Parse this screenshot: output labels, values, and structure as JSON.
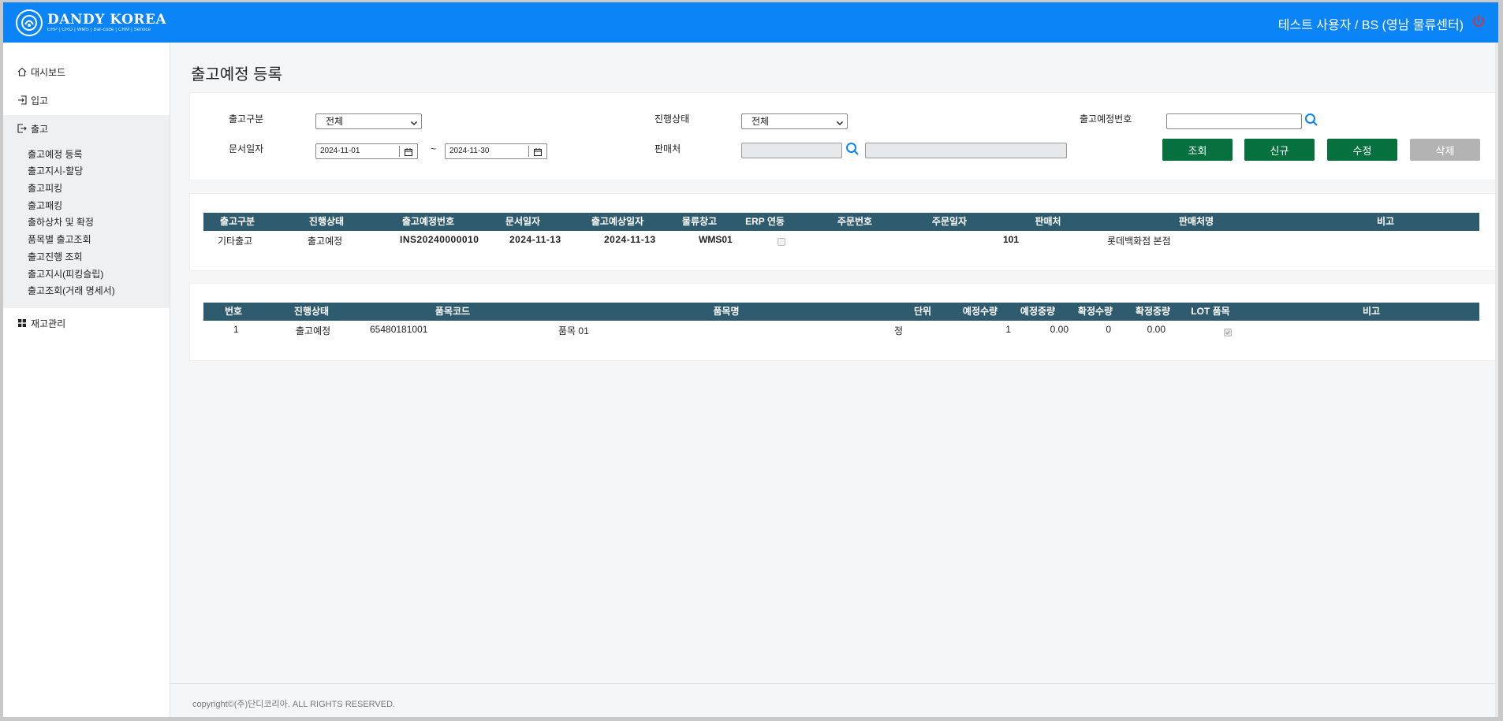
{
  "header": {
    "logo_name": "DANDY KOREA",
    "logo_sub": "ERP | CRO | WMS | Bar-code | CRM | Service",
    "user": "테스트 사용자 / BS (영남 물류센터)"
  },
  "sidebar": {
    "items": [
      {
        "label": "대시보드",
        "icon": "home-icon"
      },
      {
        "label": "입고",
        "icon": "sign-in-icon"
      },
      {
        "label": "출고",
        "icon": "sign-out-icon"
      },
      {
        "label": "재고관리",
        "icon": "grid-icon"
      }
    ],
    "sub_items": [
      "출고예정 등록",
      "출고지시-할당",
      "출고피킹",
      "출고패킹",
      "출하상차 및 확정",
      "품목별 출고조회",
      "출고진행 조회",
      "출고지시(피킹슬립)",
      "출고조회(거래 명세서)"
    ]
  },
  "page": {
    "title": "출고예정 등록"
  },
  "filters": {
    "type_label": "출고구분",
    "type_value": "전체",
    "status_label": "진행상태",
    "status_value": "전체",
    "number_label": "출고예정번호",
    "number_value": "",
    "date_label": "문서일자",
    "date_from": "2024-11-01",
    "date_to": "2024-11-30",
    "date_sep": "~",
    "seller_label": "판매처",
    "seller_code": "",
    "seller_name": ""
  },
  "buttons": {
    "search": "조회",
    "new": "신규",
    "edit": "수정",
    "delete": "삭제"
  },
  "colors": {
    "header": "#0a84f6",
    "table_header": "#2f5b6e",
    "button": "#06703e",
    "button_disabled": "#b3b3b3",
    "power": "#e03030"
  },
  "master_table": {
    "columns": [
      "출고구분",
      "진행상태",
      "출고예정번호",
      "문서일자",
      "출고예상일자",
      "물류창고",
      "ERP 연동",
      "주문번호",
      "주문일자",
      "판매처",
      "판매처명",
      "비고"
    ],
    "rows": [
      {
        "type": "기타출고",
        "status": "출고예정",
        "number": "INS20240000010",
        "doc_date": "2024-11-13",
        "expected_date": "2024-11-13",
        "warehouse": "WMS01",
        "erp_linked": false,
        "order_no": "",
        "order_date": "",
        "seller": "101",
        "seller_name": "롯데백화점 본점",
        "note": ""
      }
    ]
  },
  "detail_table": {
    "columns": [
      "번호",
      "진행상태",
      "품목코드",
      "품목명",
      "단위",
      "예정수량",
      "예정중량",
      "확정수량",
      "확정중량",
      "LOT 품목",
      "비고"
    ],
    "rows": [
      {
        "no": "1",
        "status": "출고예정",
        "item_code": "65480181001",
        "item_name": "품목 01",
        "unit": "정",
        "plan_qty": "1",
        "plan_weight": "0.00",
        "confirm_qty": "0",
        "confirm_weight": "0.00",
        "lot_item": true,
        "note": ""
      }
    ]
  },
  "footer": {
    "copyright": "copyright©(주)단디코리아. ALL RIGHTS RESERVED."
  }
}
